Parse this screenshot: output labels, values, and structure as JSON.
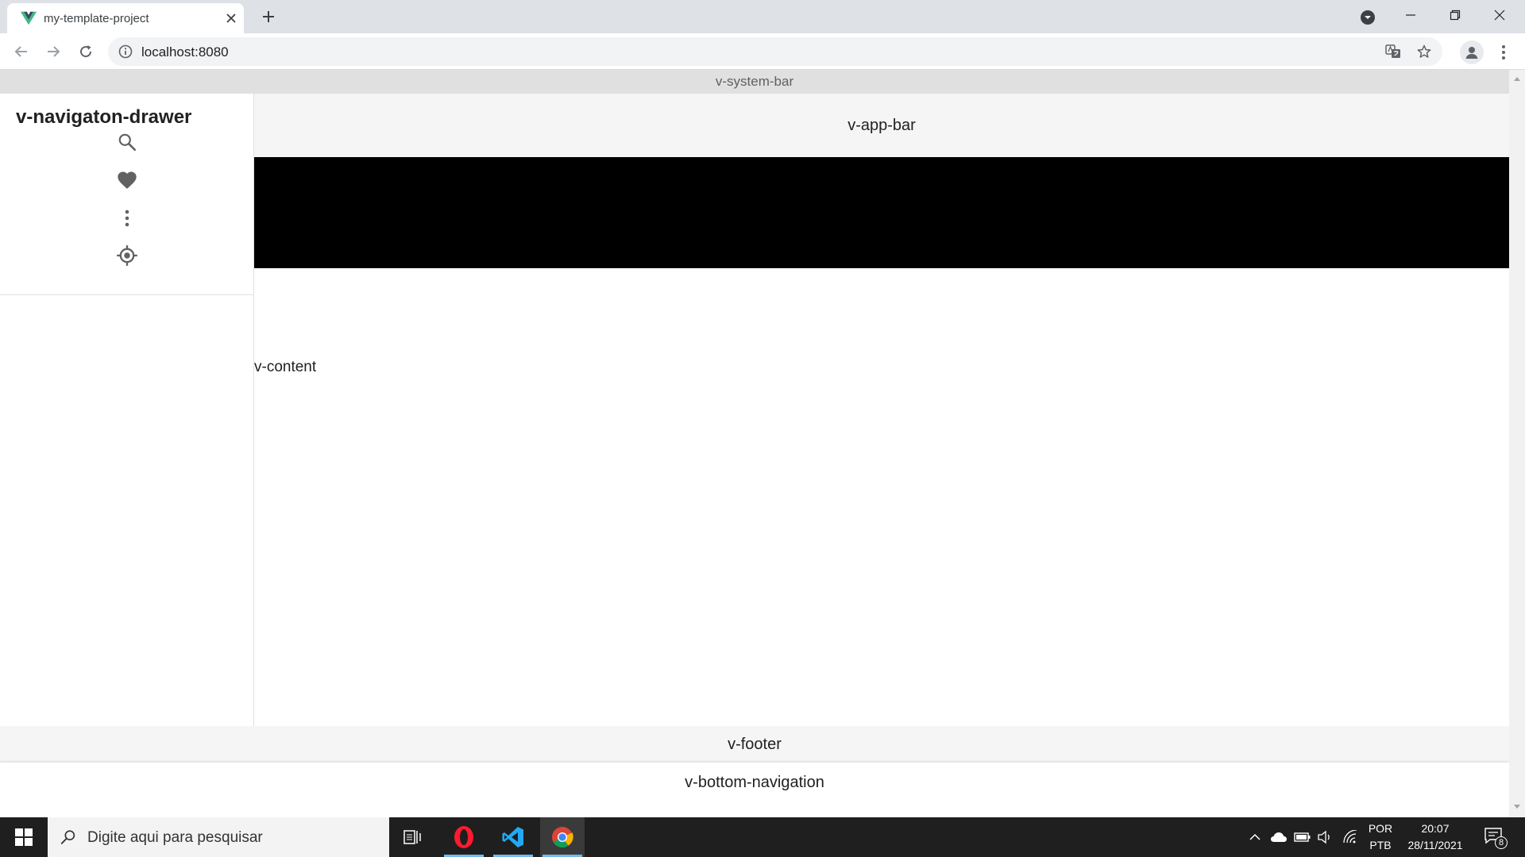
{
  "browser": {
    "tab": {
      "title": "my-template-project",
      "favicon": "vue-logo-icon"
    },
    "address": {
      "url": "localhost:8080"
    },
    "icons": [
      "back-icon",
      "forward-icon",
      "reload-icon",
      "info-icon",
      "translate-icon",
      "star-icon",
      "profile-icon",
      "menu-dots-icon",
      "tab-search-icon",
      "minimize-icon",
      "restore-icon",
      "close-icon"
    ]
  },
  "page": {
    "system_bar": {
      "label": "v-system-bar"
    },
    "drawer": {
      "title": "v-navigaton-drawer",
      "icons": [
        "search-icon",
        "heart-icon",
        "dots-vertical-icon",
        "crosshairs-gps-icon"
      ]
    },
    "app_bar": {
      "label": "v-app-bar"
    },
    "content": {
      "label": "v-content"
    },
    "footer": {
      "label": "v-footer"
    },
    "bottom_navigation": {
      "label": "v-bottom-navigation"
    }
  },
  "taskbar": {
    "search_placeholder": "Digite aqui para pesquisar",
    "apps": [
      "task-view-icon",
      "opera-icon",
      "vscode-icon",
      "chrome-icon"
    ],
    "tray": {
      "lang_top": "POR",
      "lang_bottom": "PTB",
      "time": "20:07",
      "date": "28/11/2021",
      "notification_count": "8"
    }
  },
  "colors": {
    "system_bar_bg": "#e0e0e0",
    "app_bar_bg": "#f5f5f5",
    "footer_bg": "#f5f5f5",
    "band": "#000000",
    "taskbar_bg": "#1f1f1f",
    "vue_green": "#41b883",
    "vue_dark": "#34495e"
  }
}
